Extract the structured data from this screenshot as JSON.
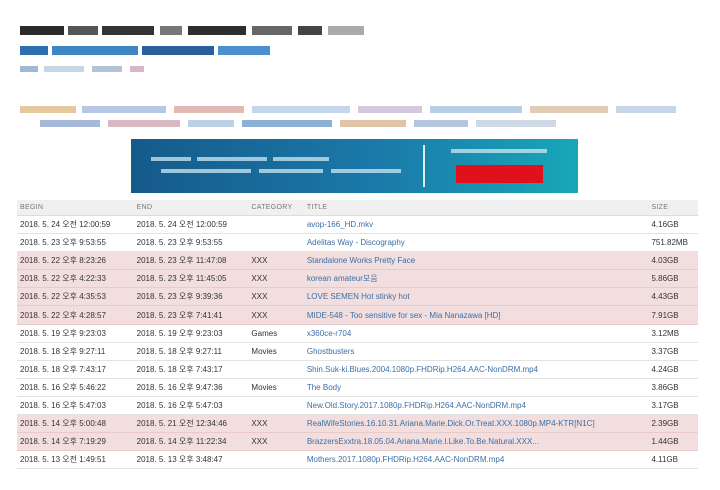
{
  "columns": {
    "begin": "BEGIN",
    "end": "END",
    "category": "CATEGORY",
    "title": "TITLE",
    "size": "SIZE"
  },
  "rows": [
    {
      "begin": "2018. 5. 24 오전 12:00:59",
      "end": "2018. 5. 24 오전 12:00:59",
      "category": "",
      "title": "avop-166_HD.mkv",
      "size": "4.16GB",
      "highlight": false
    },
    {
      "begin": "2018. 5. 23 오후 9:53:55",
      "end": "2018. 5. 23 오후 9:53:55",
      "category": "",
      "title": "Adelitas Way - Discography",
      "size": "751.82MB",
      "highlight": false
    },
    {
      "begin": "2018. 5. 22 오후 8:23:26",
      "end": "2018. 5. 23 오후 11:47:08",
      "category": "XXX",
      "title": "Standalone Works Pretty Face",
      "size": "4.03GB",
      "highlight": true
    },
    {
      "begin": "2018. 5. 22 오후 4:22:33",
      "end": "2018. 5. 23 오후 11:45:05",
      "category": "XXX",
      "title": "korean amateur모음",
      "size": "5.86GB",
      "highlight": true
    },
    {
      "begin": "2018. 5. 22 오후 4:35:53",
      "end": "2018. 5. 23 오후 9:39:36",
      "category": "XXX",
      "title": "LOVE SEMEN Hot stinky hot",
      "size": "4.43GB",
      "highlight": true
    },
    {
      "begin": "2018. 5. 22 오후 4:28:57",
      "end": "2018. 5. 23 오후 7:41:41",
      "category": "XXX",
      "title": "MIDE-548 - Too sensitive for sex - Mia Nanazawa [HD]",
      "size": "7.91GB",
      "highlight": true
    },
    {
      "begin": "2018. 5. 19 오후 9:23:03",
      "end": "2018. 5. 19 오후 9:23:03",
      "category": "Games",
      "title": "x360ce-r704",
      "size": "3.12MB",
      "highlight": false
    },
    {
      "begin": "2018. 5. 18 오후 9:27:11",
      "end": "2018. 5. 18 오후 9:27:11",
      "category": "Movies",
      "title": "Ghostbusters",
      "size": "3.37GB",
      "highlight": false
    },
    {
      "begin": "2018. 5. 18 오후 7:43:17",
      "end": "2018. 5. 18 오후 7:43:17",
      "category": "",
      "title": "Shin.Suk-ki.Blues.2004.1080p.FHDRip.H264.AAC-NonDRM.mp4",
      "size": "4.24GB",
      "highlight": false
    },
    {
      "begin": "2018. 5. 16 오후 5:46:22",
      "end": "2018. 5. 16 오후 9:47:36",
      "category": "Movies",
      "title": "The Body",
      "size": "3.86GB",
      "highlight": false
    },
    {
      "begin": "2018. 5. 16 오후 5:47:03",
      "end": "2018. 5. 16 오후 5:47:03",
      "category": "",
      "title": "New.Old.Story.2017.1080p.FHDRip.H264.AAC-NonDRM.mp4",
      "size": "3.17GB",
      "highlight": false
    },
    {
      "begin": "2018. 5. 14 오후 5:00:48",
      "end": "2018. 5. 21 오전 12:34:46",
      "category": "XXX",
      "title": "RealWifeStories.16.10.31.Ariana.Marie.Dick.Or.Treat.XXX.1080p.MP4-KTR[N1C]",
      "size": "2.39GB",
      "highlight": true
    },
    {
      "begin": "2018. 5. 14 오후 7:19:29",
      "end": "2018. 5. 14 오후 11:22:34",
      "category": "XXX",
      "title": "BrazzersExxtra.18.05.04.Ariana.Marie.I.Like.To.Be.Natural.XXX...",
      "size": "1.44GB",
      "highlight": true
    },
    {
      "begin": "2018. 5. 13 오전 1:49:51",
      "end": "2018. 5. 13 오후 3:48:47",
      "category": "",
      "title": "Mothers.2017.1080p.FHDRip.H264.AAC-NonDRM.mp4",
      "size": "4.11GB",
      "highlight": false
    }
  ],
  "colors": {
    "highlight_row": "#f2dede",
    "link": "#3b6fa6",
    "banner_button": "#e0101c"
  }
}
